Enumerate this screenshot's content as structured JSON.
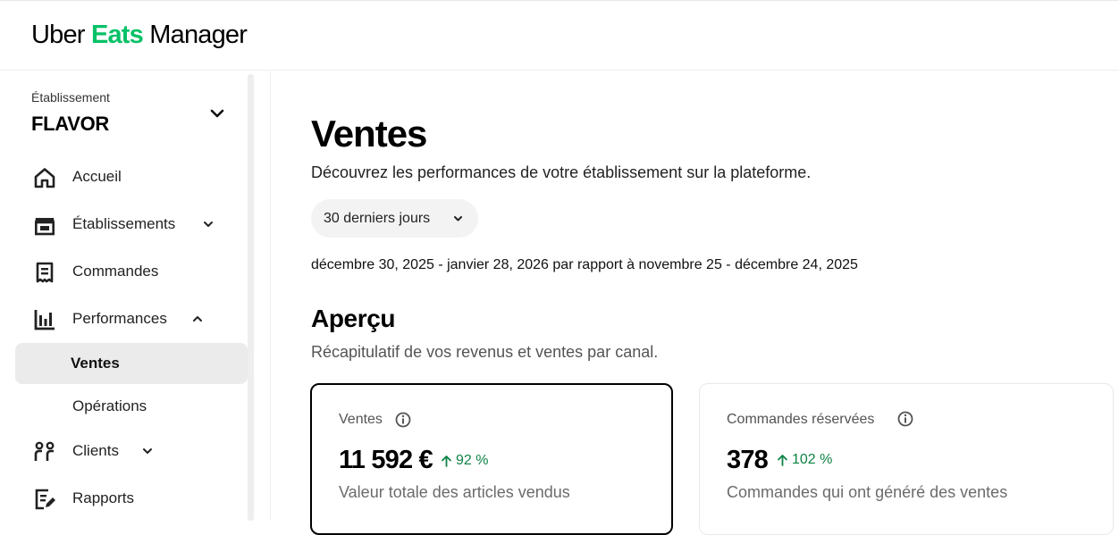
{
  "header": {
    "logo_brand": "Uber",
    "logo_accent": "Eats",
    "logo_product": "Manager",
    "accent_color": "#06c167"
  },
  "sidebar": {
    "establishment_label": "Établissement",
    "establishment_name": "FLAVOR",
    "items": [
      {
        "label": "Accueil",
        "icon": "home-icon"
      },
      {
        "label": "Établissements",
        "icon": "store-icon",
        "chevron": "down"
      },
      {
        "label": "Commandes",
        "icon": "receipt-icon"
      },
      {
        "label": "Performances",
        "icon": "bar-chart-icon",
        "chevron": "up"
      },
      {
        "label": "Ventes",
        "active": true
      },
      {
        "label": "Opérations"
      },
      {
        "label": "Clients",
        "icon": "users-icon",
        "chevron": "down"
      },
      {
        "label": "Rapports",
        "icon": "report-icon"
      }
    ]
  },
  "main": {
    "title": "Ventes",
    "subtitle": "Découvrez les performances de votre établissement sur la plateforme.",
    "range_button": "30 derniers jours",
    "date_range": "décembre 30, 2025 - janvier 28, 2026 par rapport à novembre 25 - décembre 24, 2025",
    "overview_title": "Aperçu",
    "overview_subtitle": "Récapitulatif de vos revenus et ventes par canal.",
    "cards": [
      {
        "title": "Ventes",
        "value": "11 592 €",
        "delta": "92 %",
        "description": "Valeur totale des articles vendus",
        "selected": true
      },
      {
        "title": "Commandes réservées",
        "value": "378",
        "delta": "102 %",
        "description": "Commandes qui ont généré des ventes",
        "selected": false
      }
    ],
    "positive_color": "#0e8345"
  }
}
